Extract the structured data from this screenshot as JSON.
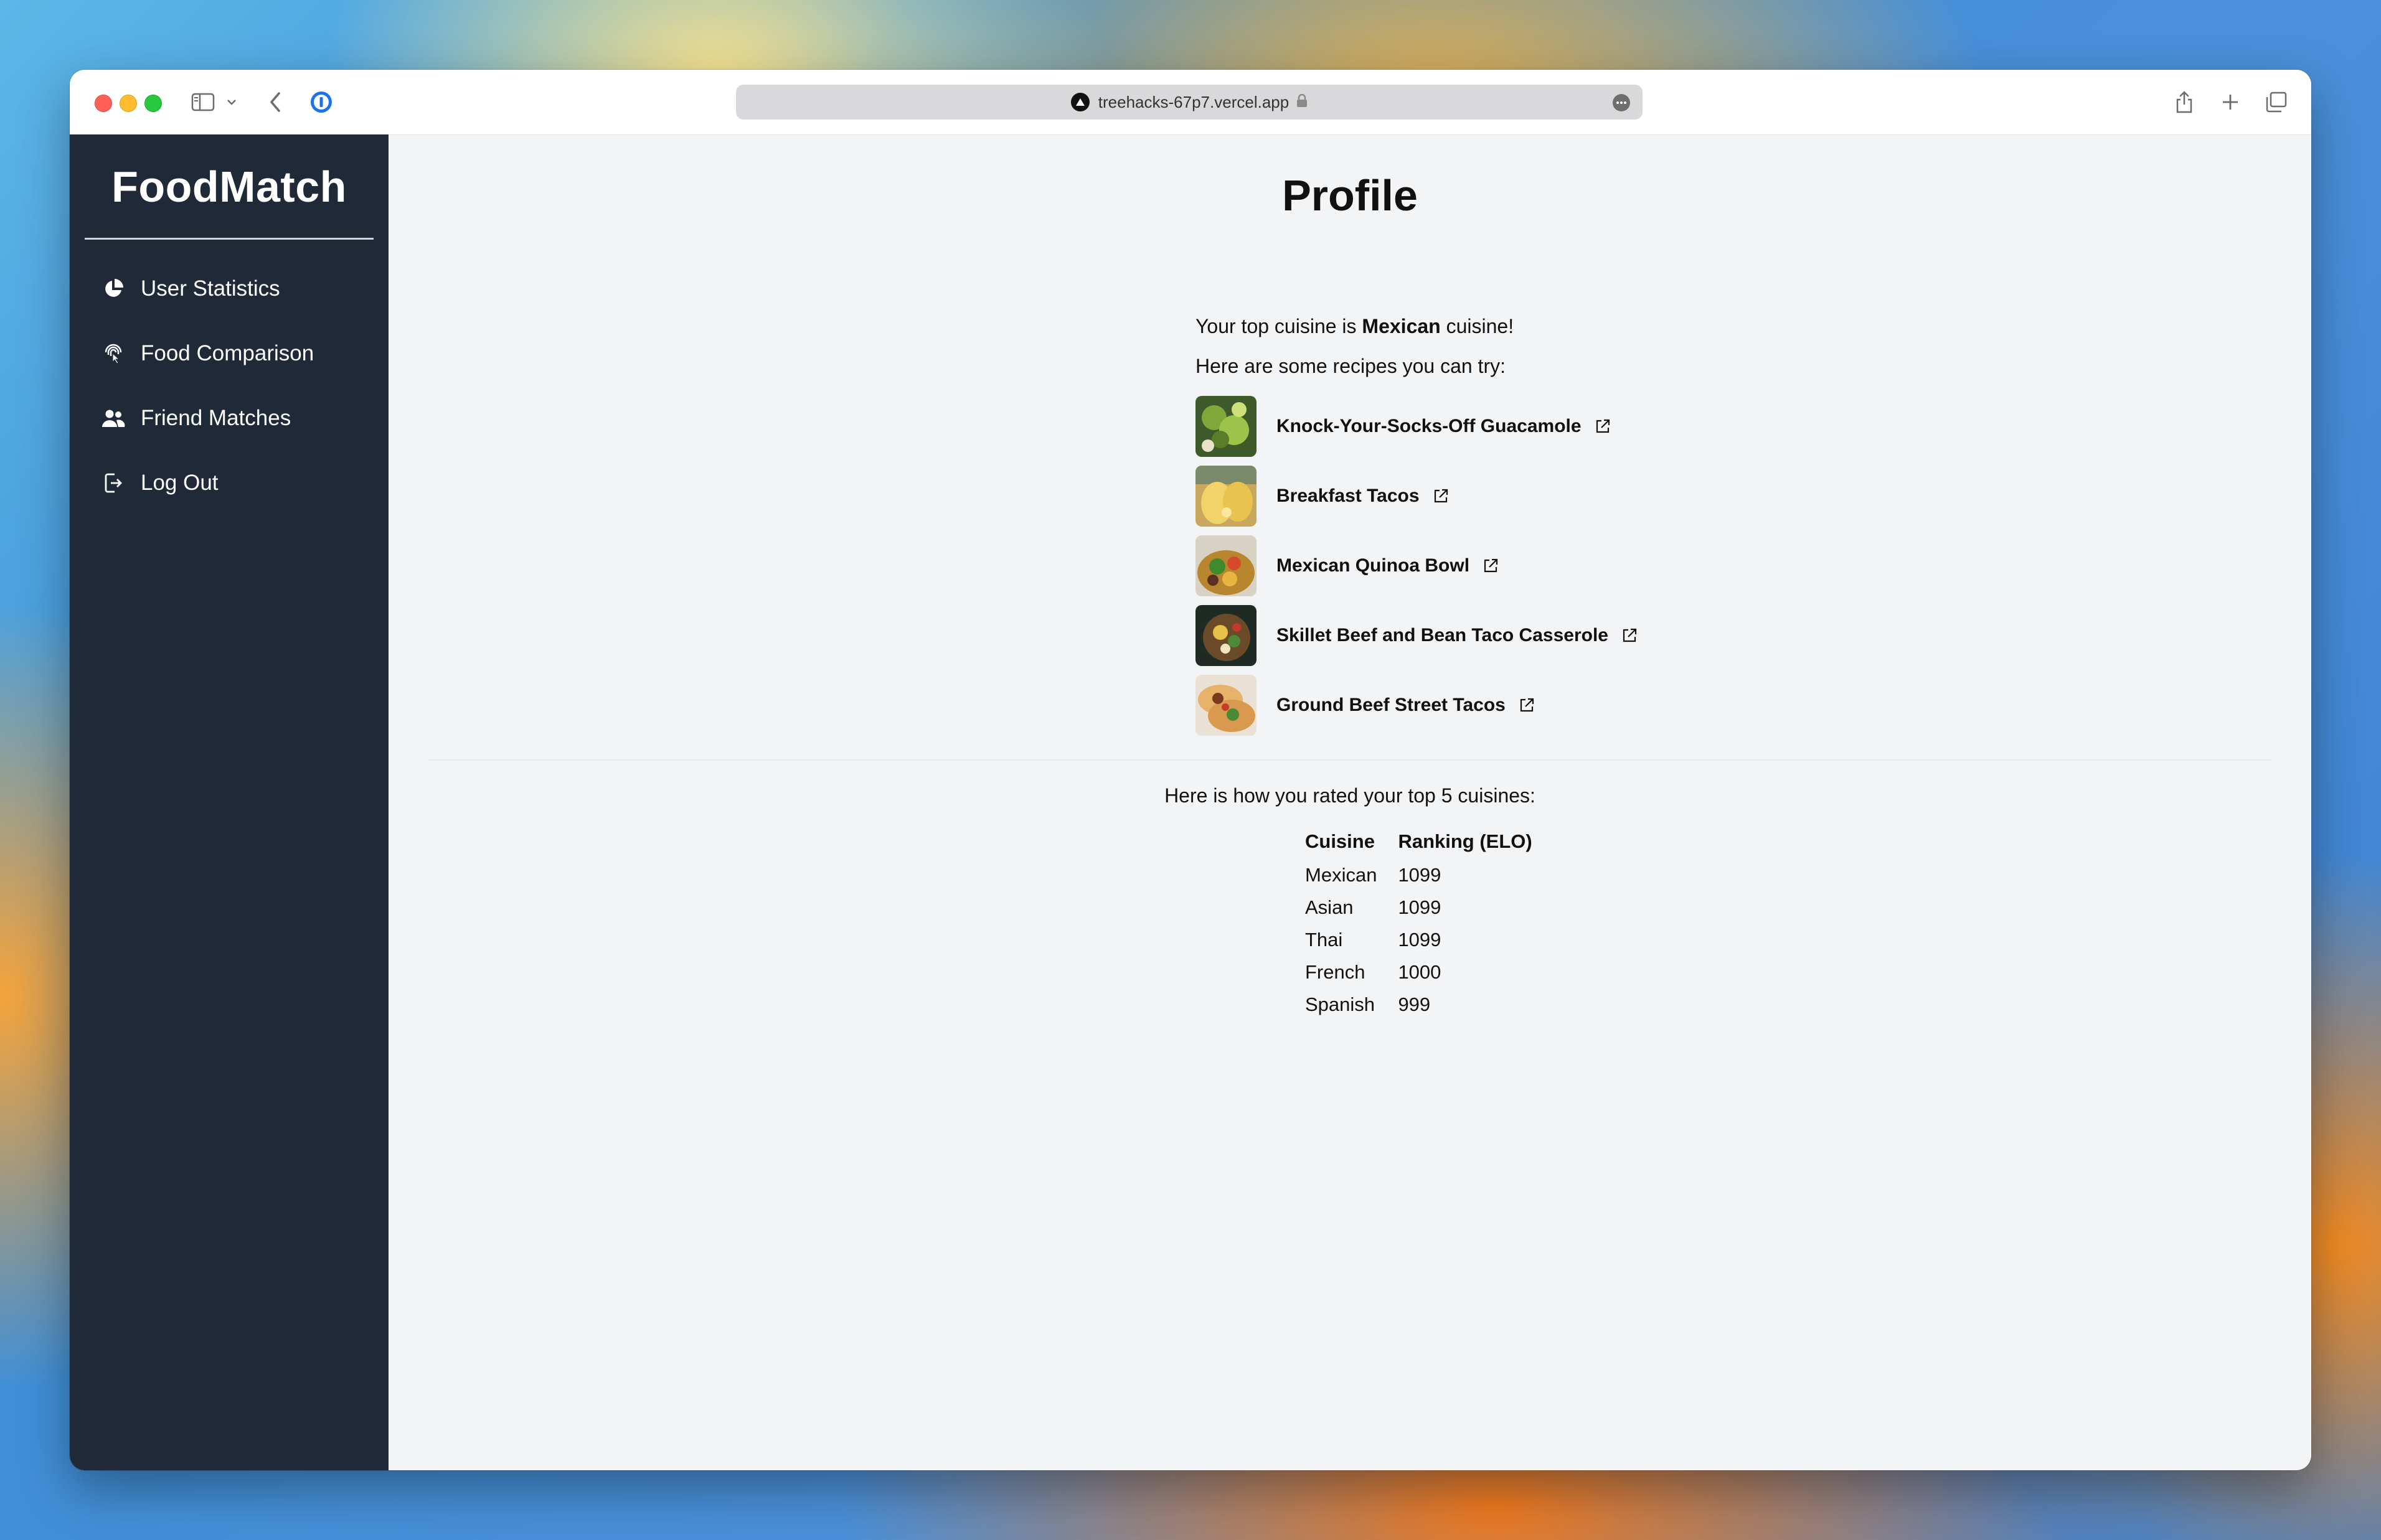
{
  "browser": {
    "url": "treehacks-67p7.vercel.app"
  },
  "sidebar": {
    "brand": "FoodMatch",
    "items": [
      {
        "label": "User Statistics",
        "icon": "pie-chart-icon"
      },
      {
        "label": "Food Comparison",
        "icon": "fingerprint-icon"
      },
      {
        "label": "Friend Matches",
        "icon": "users-icon"
      },
      {
        "label": "Log Out",
        "icon": "logout-icon"
      }
    ]
  },
  "main": {
    "title": "Profile",
    "top_cuisine_prefix": "Your top cuisine is ",
    "top_cuisine": "Mexican",
    "top_cuisine_suffix": " cuisine!",
    "recipes_intro": "Here are some recipes you can try:",
    "recipes": [
      {
        "name": "Knock-Your-Socks-Off Guacamole"
      },
      {
        "name": "Breakfast Tacos"
      },
      {
        "name": "Mexican Quinoa Bowl"
      },
      {
        "name": "Skillet Beef and Bean Taco Casserole"
      },
      {
        "name": "Ground Beef Street Tacos"
      }
    ],
    "rated_intro": "Here is how you rated your top 5 cuisines:",
    "table": {
      "headers": [
        "Cuisine",
        "Ranking (ELO)"
      ],
      "rows": [
        [
          "Mexican",
          "1099"
        ],
        [
          "Asian",
          "1099"
        ],
        [
          "Thai",
          "1099"
        ],
        [
          "French",
          "1000"
        ],
        [
          "Spanish",
          "999"
        ]
      ]
    }
  }
}
